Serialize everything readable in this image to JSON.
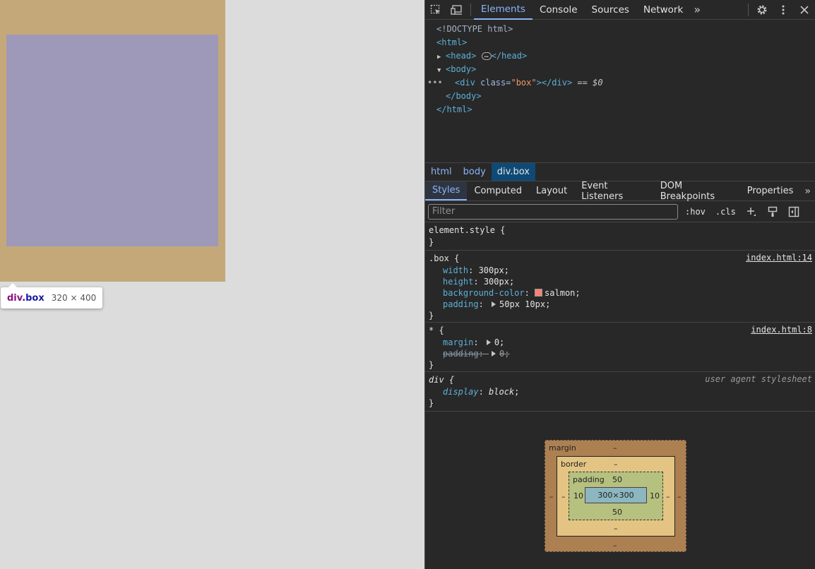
{
  "page": {
    "tooltip": {
      "tag": "div",
      "class": ".box",
      "dims": "320 × 400"
    }
  },
  "devtools": {
    "main_tabs": [
      "Elements",
      "Console",
      "Sources",
      "Network"
    ],
    "dom": {
      "doctype": "<!DOCTYPE html>",
      "html_open": "<html>",
      "head_open": "<head>",
      "head_close": "</head>",
      "body_open": "<body>",
      "div_open_tag": "<div",
      "div_attr": " class=",
      "div_attr_value": "\"box\"",
      "div_close": "></div>",
      "selected_marker": " == ",
      "selected_var": "$0",
      "body_close": "</body>",
      "html_close": "</html>"
    },
    "breadcrumbs": [
      "html",
      "body",
      "div.box"
    ],
    "sub_tabs": [
      "Styles",
      "Computed",
      "Layout",
      "Event Listeners",
      "DOM Breakpoints",
      "Properties"
    ],
    "filter": {
      "placeholder": "Filter",
      "hov": ":hov",
      "cls": ".cls"
    },
    "rules": {
      "element_style": {
        "selector": "element.style {",
        "close": "}"
      },
      "box": {
        "selector": ".box {",
        "source": "index.html:14",
        "width_name": "width",
        "width_value": "300px",
        "height_name": "height",
        "height_value": "300px",
        "bg_name": "background-color",
        "bg_value": "salmon",
        "padding_name": "padding",
        "padding_value": "50px 10px",
        "close": "}"
      },
      "universal": {
        "selector": "* {",
        "source": "index.html:8",
        "margin_name": "margin",
        "margin_value": "0",
        "padding_name": "padding",
        "padding_value": "0",
        "close": "}"
      },
      "div_ua": {
        "selector": "div {",
        "source": "user agent stylesheet",
        "display_name": "display",
        "display_value": "block",
        "close": "}"
      }
    },
    "box_model": {
      "margin_label": "margin",
      "border_label": "border",
      "padding_label": "padding",
      "margin_top": "–",
      "margin_bottom": "–",
      "margin_left": "–",
      "margin_right": "–",
      "border_top": "–",
      "border_bottom": "–",
      "border_left": "–",
      "border_right": "–",
      "padding_top": "50",
      "padding_bottom": "50",
      "padding_left": "10",
      "padding_right": "10",
      "content": "300×300"
    },
    "colors": {
      "accent": "#8ab4f8",
      "highlight_margin": "#c4a879",
      "highlight_content": "#9e99b8",
      "swatch": "#fa8072"
    }
  }
}
